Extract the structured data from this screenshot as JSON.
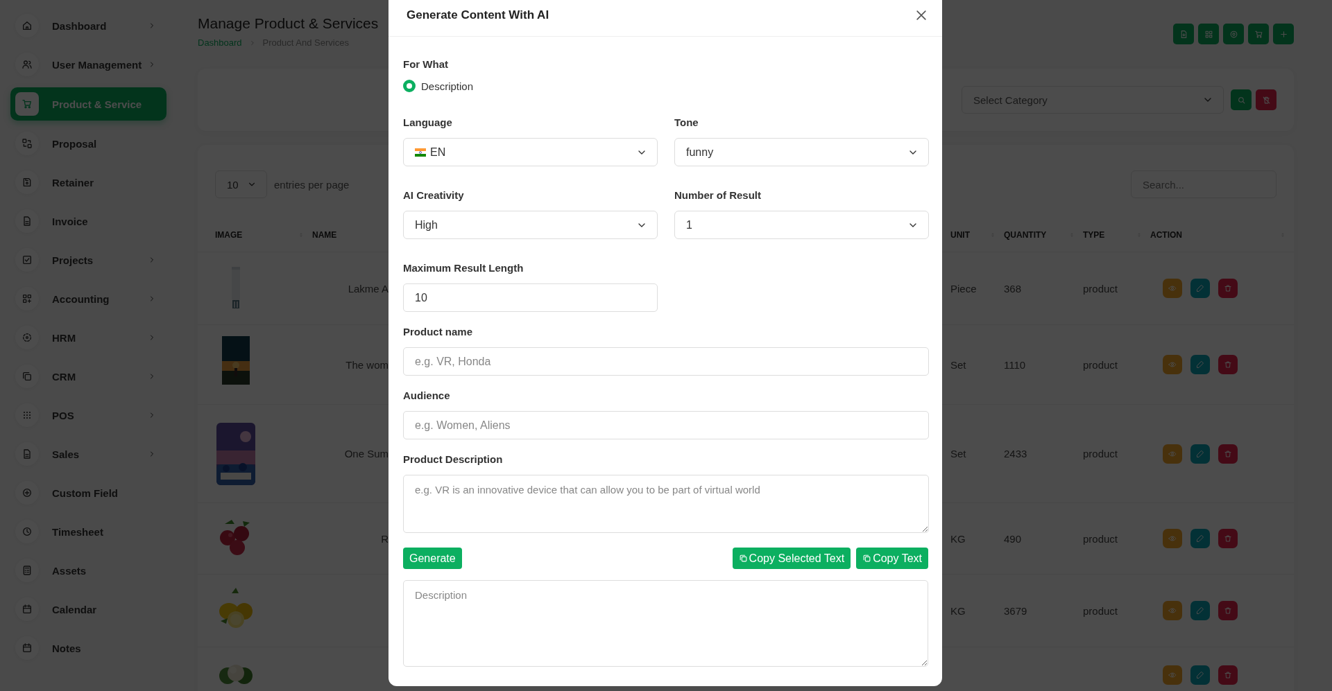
{
  "sidebar": {
    "items": [
      {
        "label": "Dashboard",
        "selected": false,
        "has_submenu": true
      },
      {
        "label": "User Management",
        "selected": false,
        "has_submenu": true
      },
      {
        "label": "Product & Service",
        "selected": true,
        "has_submenu": false
      },
      {
        "label": "Proposal",
        "selected": false,
        "has_submenu": false
      },
      {
        "label": "Retainer",
        "selected": false,
        "has_submenu": false
      },
      {
        "label": "Invoice",
        "selected": false,
        "has_submenu": false
      },
      {
        "label": "Projects",
        "selected": false,
        "has_submenu": true
      },
      {
        "label": "Accounting",
        "selected": false,
        "has_submenu": true
      },
      {
        "label": "HRM",
        "selected": false,
        "has_submenu": true
      },
      {
        "label": "CRM",
        "selected": false,
        "has_submenu": true
      },
      {
        "label": "POS",
        "selected": false,
        "has_submenu": true
      },
      {
        "label": "Sales",
        "selected": false,
        "has_submenu": true
      },
      {
        "label": "Custom Field",
        "selected": false,
        "has_submenu": false
      },
      {
        "label": "Timesheet",
        "selected": false,
        "has_submenu": false
      },
      {
        "label": "Assets",
        "selected": false,
        "has_submenu": false
      },
      {
        "label": "Calendar",
        "selected": false,
        "has_submenu": false
      },
      {
        "label": "Notes",
        "selected": false,
        "has_submenu": false
      }
    ]
  },
  "page": {
    "title": "Manage Product & Services",
    "breadcrumb": [
      "Dashboard",
      "Product And Services"
    ]
  },
  "filter": {
    "category_select": {
      "placeholder": "Select Category"
    }
  },
  "table": {
    "entries_per_page": {
      "value": "10",
      "label": "entries per page"
    },
    "search": {
      "placeholder": "Search..."
    },
    "columns": [
      {
        "label": "IMAGE",
        "sortable": true
      },
      {
        "label": "NAME",
        "sortable": false
      },
      {
        "label": "UNIT",
        "sortable": true
      },
      {
        "label": "QUANTITY",
        "sortable": true
      },
      {
        "label": "TYPE",
        "sortable": true
      },
      {
        "label": "ACTION",
        "sortable": true
      }
    ],
    "rows": [
      {
        "image": {
          "kind": "picture"
        },
        "name": "Lakme A",
        "unit": "Piece",
        "quantity": "368",
        "type": "product"
      },
      {
        "image": {
          "kind": "picture"
        },
        "name": "The wom",
        "unit": "Set",
        "quantity": "1110",
        "type": "product"
      },
      {
        "image": {
          "kind": "picture"
        },
        "name": "One Sum",
        "unit": "Set",
        "quantity": "2433",
        "type": "product"
      },
      {
        "image": {
          "kind": "picture"
        },
        "name": "R",
        "unit": "KG",
        "quantity": "490",
        "type": "product"
      },
      {
        "image": {
          "kind": "picture"
        },
        "unit": "KG",
        "quantity": "3679",
        "type": "product"
      },
      {
        "image": {
          "kind": "picture"
        }
      }
    ]
  },
  "modal": {
    "title": "Generate Content With AI",
    "for_what": {
      "label": "For What",
      "options": [
        {
          "label": "Description",
          "selected": true
        }
      ]
    },
    "fields": [
      {
        "kind": "select",
        "label": "Language",
        "value": "EN",
        "flag": true
      },
      {
        "kind": "select",
        "label": "Tone",
        "value": "funny"
      },
      {
        "kind": "select",
        "label": "AI Creativity",
        "value": "High"
      },
      {
        "kind": "select",
        "label": "Number of Result",
        "value": "1"
      },
      {
        "kind": "number",
        "label": "Maximum Result Length",
        "value": "10"
      },
      {
        "kind": "text",
        "label": "Product name",
        "placeholder": "e.g. VR, Honda"
      },
      {
        "kind": "text",
        "label": "Audience",
        "placeholder": "e.g. Women, Aliens"
      },
      {
        "kind": "textarea",
        "label": "Product Description",
        "placeholder": "e.g. VR is an innovative device that can allow you to be part of virtual world"
      }
    ],
    "actions": [
      {
        "label": "Generate",
        "kind": "generate"
      },
      {
        "label": "Copy Selected Text",
        "kind": "copy"
      },
      {
        "label": "Copy Text",
        "kind": "copy"
      }
    ],
    "result": {
      "placeholder": "Description"
    }
  }
}
